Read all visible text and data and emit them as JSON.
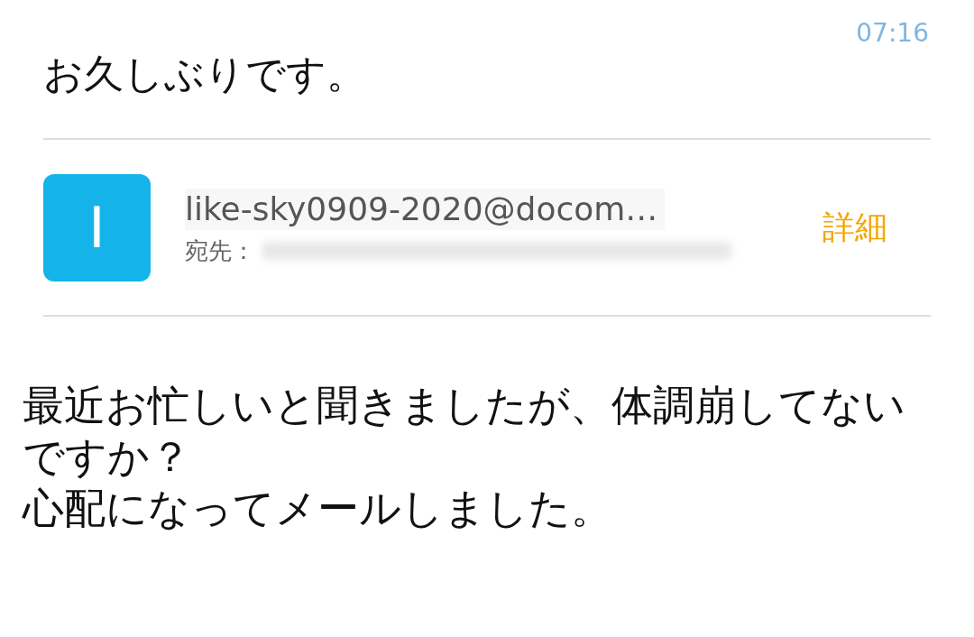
{
  "time": "07:16",
  "subject": "お久しぶりです。",
  "sender": {
    "avatar_letter": "I",
    "address": "like-sky0909-2020@docom…",
    "to_label": "宛先：",
    "details_link": "詳細"
  },
  "body": [
    "最近お忙しいと聞きましたが、体調崩してないですか？",
    "心配になってメールしました。"
  ]
}
